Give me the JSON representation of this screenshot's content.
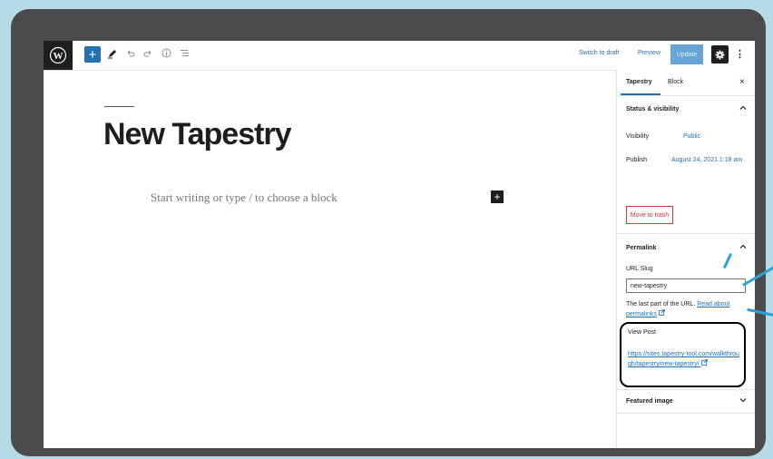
{
  "toolbar": {
    "switch_to_draft": "Switch to draft",
    "preview": "Preview",
    "update": "Update",
    "add": "+",
    "more": "⋮"
  },
  "editor": {
    "title": "New Tapestry",
    "placeholder": "Start writing or type / to choose a block",
    "inserter": "+"
  },
  "sidebar": {
    "tabs": [
      "Tapestry",
      "Block"
    ],
    "close": "×",
    "status_visibility": {
      "heading": "Status & visibility",
      "visibility_label": "Visibility",
      "visibility_value": "Public",
      "publish_label": "Publish",
      "publish_value": "August 24, 2021 1:18 am",
      "trash_label": "Move to trash"
    },
    "permalink": {
      "heading": "Permalink",
      "slug_label": "URL Slug",
      "slug_value": "new-tapestry",
      "help_text": "The last part of the URL.",
      "help_link": "Read about permalinks",
      "view_post_label": "View Post",
      "view_post_url": "https://sites.tapestry-tool.com/walkthrough/tapestry/new-tapestry/"
    },
    "featured_image": {
      "heading": "Featured image"
    }
  },
  "colors": {
    "accent": "#2271b1",
    "background": "#b6dbe6",
    "frame": "#4b4b4d",
    "trash": "#d63638"
  }
}
